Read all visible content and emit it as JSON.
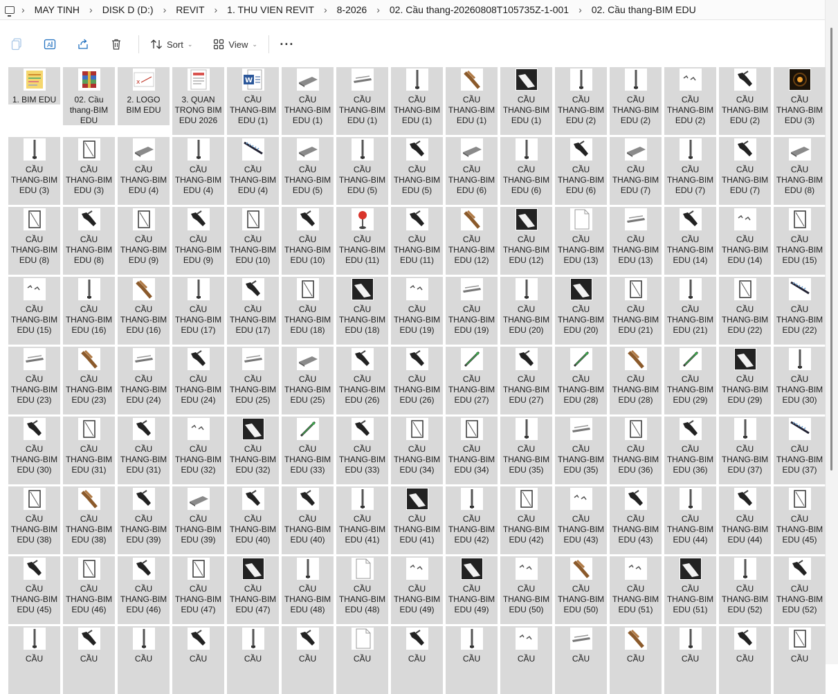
{
  "breadcrumb": {
    "icon": "computer-icon",
    "items": [
      "MAY TINH",
      "DISK D (D:)",
      "REVIT",
      "1. THU VIEN REVIT",
      "8-2026",
      "02. Cầu thang-20260808T105735Z-1-001",
      "02. Cầu thang-BIM EDU"
    ],
    "separator": "›"
  },
  "toolbar": {
    "sort_label": "Sort",
    "view_label": "View",
    "more_label": "···",
    "icons": [
      "copy-icon",
      "rename-icon",
      "share-icon",
      "delete-icon",
      "sort-icon",
      "view-icon",
      "more-icon"
    ]
  },
  "files": [
    {
      "name": "1. BIM EDU",
      "icon": "note-icon",
      "h": "short"
    },
    {
      "name": "02. Cầu thang-BIM EDU",
      "icon": "archive-icon",
      "h": "mid"
    },
    {
      "name": "2. LOGO BIM EDU",
      "icon": "logo-icon",
      "h": "mid"
    },
    {
      "name": "3. QUAN TRỌNG BIM EDU 2026",
      "icon": "doc-icon",
      "h": "full"
    },
    {
      "name": "CẦU THANG-BIM EDU (1)",
      "icon": "word-icon"
    },
    {
      "name": "CẦU THANG-BIM EDU (1)",
      "icon": "slab-icon"
    },
    {
      "name": "CẦU THANG-BIM EDU (1)",
      "icon": "flat-icon"
    },
    {
      "name": "CẦU THANG-BIM EDU (1)",
      "icon": "post-icon"
    },
    {
      "name": "CẦU THANG-BIM EDU (1)",
      "icon": "wood-icon"
    },
    {
      "name": "CẦU THANG-BIM EDU (1)",
      "icon": "dark-icon"
    },
    {
      "name": "CẦU THANG-BIM EDU (2)",
      "icon": "post-icon"
    },
    {
      "name": "CẦU THANG-BIM EDU (2)",
      "icon": "post-icon"
    },
    {
      "name": "CẦU THANG-BIM EDU (2)",
      "icon": "small-icon"
    },
    {
      "name": "CẦU THANG-BIM EDU (2)",
      "icon": "stair-icon"
    },
    {
      "name": "CẦU THANG-BIM EDU (3)",
      "icon": "night-icon"
    },
    {
      "name": "CẦU THANG-BIM EDU (3)",
      "icon": "post-icon"
    },
    {
      "name": "CẦU THANG-BIM EDU (3)",
      "icon": "frame-icon"
    },
    {
      "name": "CẦU THANG-BIM EDU (4)",
      "icon": "slab-icon"
    },
    {
      "name": "CẦU THANG-BIM EDU (4)",
      "icon": "post-icon"
    },
    {
      "name": "CẦU THANG-BIM EDU (4)",
      "icon": "diag-icon"
    },
    {
      "name": "CẦU THANG-BIM EDU (5)",
      "icon": "slab-icon"
    },
    {
      "name": "CẦU THANG-BIM EDU (5)",
      "icon": "post-icon"
    },
    {
      "name": "CẦU THANG-BIM EDU (5)",
      "icon": "stair-icon"
    },
    {
      "name": "CẦU THANG-BIM EDU (6)",
      "icon": "slab-icon"
    },
    {
      "name": "CẦU THANG-BIM EDU (6)",
      "icon": "post-icon"
    },
    {
      "name": "CẦU THANG-BIM EDU (6)",
      "icon": "stair-icon"
    },
    {
      "name": "CẦU THANG-BIM EDU (7)",
      "icon": "slab-icon"
    },
    {
      "name": "CẦU THANG-BIM EDU (7)",
      "icon": "post-icon"
    },
    {
      "name": "CẦU THANG-BIM EDU (7)",
      "icon": "stair-icon"
    },
    {
      "name": "CẦU THANG-BIM EDU (8)",
      "icon": "slab-icon"
    },
    {
      "name": "CẦU THANG-BIM EDU (8)",
      "icon": "frame-icon"
    },
    {
      "name": "CẦU THANG-BIM EDU (8)",
      "icon": "stair-icon"
    },
    {
      "name": "CẦU THANG-BIM EDU (9)",
      "icon": "frame-icon"
    },
    {
      "name": "CẦU THANG-BIM EDU (9)",
      "icon": "stair-icon"
    },
    {
      "name": "CẦU THANG-BIM EDU (10)",
      "icon": "frame-icon"
    },
    {
      "name": "CẦU THANG-BIM EDU (10)",
      "icon": "stair-icon"
    },
    {
      "name": "CẦU THANG-BIM EDU (11)",
      "icon": "red-icon"
    },
    {
      "name": "CẦU THANG-BIM EDU (11)",
      "icon": "stair-icon"
    },
    {
      "name": "CẦU THANG-BIM EDU (12)",
      "icon": "wood-icon"
    },
    {
      "name": "CẦU THANG-BIM EDU (12)",
      "icon": "dark-icon"
    },
    {
      "name": "CẦU THANG-BIM EDU (13)",
      "icon": "blank-icon"
    },
    {
      "name": "CẦU THANG-BIM EDU (13)",
      "icon": "flat-icon"
    },
    {
      "name": "CẦU THANG-BIM EDU (14)",
      "icon": "stair-icon"
    },
    {
      "name": "CẦU THANG-BIM EDU (14)",
      "icon": "small-icon"
    },
    {
      "name": "CẦU THANG-BIM EDU (15)",
      "icon": "frame-icon"
    },
    {
      "name": "CẦU THANG-BIM EDU (15)",
      "icon": "small-icon"
    },
    {
      "name": "CẦU THANG-BIM EDU (16)",
      "icon": "post-icon"
    },
    {
      "name": "CẦU THANG-BIM EDU (16)",
      "icon": "wood-icon"
    },
    {
      "name": "CẦU THANG-BIM EDU (17)",
      "icon": "post-icon"
    },
    {
      "name": "CẦU THANG-BIM EDU (17)",
      "icon": "stair-icon"
    },
    {
      "name": "CẦU THANG-BIM EDU (18)",
      "icon": "frame-icon"
    },
    {
      "name": "CẦU THANG-BIM EDU (18)",
      "icon": "dark-icon"
    },
    {
      "name": "CẦU THANG-BIM EDU (19)",
      "icon": "small-icon"
    },
    {
      "name": "CẦU THANG-BIM EDU (19)",
      "icon": "flat-icon"
    },
    {
      "name": "CẦU THANG-BIM EDU (20)",
      "icon": "post-icon"
    },
    {
      "name": "CẦU THANG-BIM EDU (20)",
      "icon": "dark-icon"
    },
    {
      "name": "CẦU THANG-BIM EDU (21)",
      "icon": "frame-icon"
    },
    {
      "name": "CẦU THANG-BIM EDU (21)",
      "icon": "post-icon"
    },
    {
      "name": "CẦU THANG-BIM EDU (22)",
      "icon": "frame-icon"
    },
    {
      "name": "CẦU THANG-BIM EDU (22)",
      "icon": "diag-icon"
    },
    {
      "name": "CẦU THANG-BIM EDU (23)",
      "icon": "flat-icon"
    },
    {
      "name": "CẦU THANG-BIM EDU (23)",
      "icon": "wood-icon"
    },
    {
      "name": "CẦU THANG-BIM EDU (24)",
      "icon": "flat-icon"
    },
    {
      "name": "CẦU THANG-BIM EDU (24)",
      "icon": "stair-icon"
    },
    {
      "name": "CẦU THANG-BIM EDU (25)",
      "icon": "flat-icon"
    },
    {
      "name": "CẦU THANG-BIM EDU (25)",
      "icon": "slab-icon"
    },
    {
      "name": "CẦU THANG-BIM EDU (26)",
      "icon": "stair-icon"
    },
    {
      "name": "CẦU THANG-BIM EDU (26)",
      "icon": "stair-icon"
    },
    {
      "name": "CẦU THANG-BIM EDU (27)",
      "icon": "green-icon"
    },
    {
      "name": "CẦU THANG-BIM EDU (27)",
      "icon": "stair-icon"
    },
    {
      "name": "CẦU THANG-BIM EDU (28)",
      "icon": "green-icon"
    },
    {
      "name": "CẦU THANG-BIM EDU (28)",
      "icon": "wood-icon"
    },
    {
      "name": "CẦU THANG-BIM EDU (29)",
      "icon": "green-icon"
    },
    {
      "name": "CẦU THANG-BIM EDU (29)",
      "icon": "dark-icon"
    },
    {
      "name": "CẦU THANG-BIM EDU (30)",
      "icon": "post-icon"
    },
    {
      "name": "CẦU THANG-BIM EDU (30)",
      "icon": "stair-icon"
    },
    {
      "name": "CẦU THANG-BIM EDU (31)",
      "icon": "frame-icon"
    },
    {
      "name": "CẦU THANG-BIM EDU (31)",
      "icon": "stair-icon"
    },
    {
      "name": "CẦU THANG-BIM EDU (32)",
      "icon": "small-icon"
    },
    {
      "name": "CẦU THANG-BIM EDU (32)",
      "icon": "dark-icon"
    },
    {
      "name": "CẦU THANG-BIM EDU (33)",
      "icon": "green-icon"
    },
    {
      "name": "CẦU THANG-BIM EDU (33)",
      "icon": "stair-icon"
    },
    {
      "name": "CẦU THANG-BIM EDU (34)",
      "icon": "frame-icon"
    },
    {
      "name": "CẦU THANG-BIM EDU (34)",
      "icon": "frame-icon"
    },
    {
      "name": "CẦU THANG-BIM EDU (35)",
      "icon": "post-icon"
    },
    {
      "name": "CẦU THANG-BIM EDU (35)",
      "icon": "flat-icon"
    },
    {
      "name": "CẦU THANG-BIM EDU (36)",
      "icon": "frame-icon"
    },
    {
      "name": "CẦU THANG-BIM EDU (36)",
      "icon": "stair-icon"
    },
    {
      "name": "CẦU THANG-BIM EDU (37)",
      "icon": "post-icon"
    },
    {
      "name": "CẦU THANG-BIM EDU (37)",
      "icon": "diag-icon"
    },
    {
      "name": "CẦU THANG-BIM EDU (38)",
      "icon": "frame-icon"
    },
    {
      "name": "CẦU THANG-BIM EDU (38)",
      "icon": "wood-icon"
    },
    {
      "name": "CẦU THANG-BIM EDU (39)",
      "icon": "stair-icon"
    },
    {
      "name": "CẦU THANG-BIM EDU (39)",
      "icon": "slab-icon"
    },
    {
      "name": "CẦU THANG-BIM EDU (40)",
      "icon": "stair-icon"
    },
    {
      "name": "CẦU THANG-BIM EDU (40)",
      "icon": "stair-icon"
    },
    {
      "name": "CẦU THANG-BIM EDU (41)",
      "icon": "post-icon"
    },
    {
      "name": "CẦU THANG-BIM EDU (41)",
      "icon": "dark-icon"
    },
    {
      "name": "CẦU THANG-BIM EDU (42)",
      "icon": "post-icon"
    },
    {
      "name": "CẦU THANG-BIM EDU (42)",
      "icon": "frame-icon"
    },
    {
      "name": "CẦU THANG-BIM EDU (43)",
      "icon": "small-icon"
    },
    {
      "name": "CẦU THANG-BIM EDU (43)",
      "icon": "stair-icon"
    },
    {
      "name": "CẦU THANG-BIM EDU (44)",
      "icon": "post-icon"
    },
    {
      "name": "CẦU THANG-BIM EDU (44)",
      "icon": "stair-icon"
    },
    {
      "name": "CẦU THANG-BIM EDU (45)",
      "icon": "frame-icon"
    },
    {
      "name": "CẦU THANG-BIM EDU (45)",
      "icon": "stair-icon"
    },
    {
      "name": "CẦU THANG-BIM EDU (46)",
      "icon": "frame-icon"
    },
    {
      "name": "CẦU THANG-BIM EDU (46)",
      "icon": "stair-icon"
    },
    {
      "name": "CẦU THANG-BIM EDU (47)",
      "icon": "frame-icon"
    },
    {
      "name": "CẦU THANG-BIM EDU (47)",
      "icon": "dark-icon"
    },
    {
      "name": "CẦU THANG-BIM EDU (48)",
      "icon": "post-icon"
    },
    {
      "name": "CẦU THANG-BIM EDU (48)",
      "icon": "blank-icon"
    },
    {
      "name": "CẦU THANG-BIM EDU (49)",
      "icon": "small-icon"
    },
    {
      "name": "CẦU THANG-BIM EDU (49)",
      "icon": "dark-icon"
    },
    {
      "name": "CẦU THANG-BIM EDU (50)",
      "icon": "small-icon"
    },
    {
      "name": "CẦU THANG-BIM EDU (50)",
      "icon": "wood-icon"
    },
    {
      "name": "CẦU THANG-BIM EDU (51)",
      "icon": "small-icon"
    },
    {
      "name": "CẦU THANG-BIM EDU (51)",
      "icon": "dark-icon"
    },
    {
      "name": "CẦU THANG-BIM EDU (52)",
      "icon": "post-icon"
    },
    {
      "name": "CẦU THANG-BIM EDU (52)",
      "icon": "stair-icon"
    },
    {
      "name": "CẦU",
      "icon": "post-icon",
      "partial": true
    },
    {
      "name": "CẦU",
      "icon": "stair-icon",
      "partial": true
    },
    {
      "name": "CẦU",
      "icon": "post-icon",
      "partial": true
    },
    {
      "name": "CẦU",
      "icon": "stair-icon",
      "partial": true
    },
    {
      "name": "CẦU",
      "icon": "post-icon",
      "partial": true
    },
    {
      "name": "CẦU",
      "icon": "stair-icon",
      "partial": true
    },
    {
      "name": "CẦU",
      "icon": "blank-icon",
      "partial": true
    },
    {
      "name": "CẦU",
      "icon": "stair-icon",
      "partial": true
    },
    {
      "name": "CẦU",
      "icon": "post-icon",
      "partial": true
    },
    {
      "name": "CẦU",
      "icon": "small-icon",
      "partial": true
    },
    {
      "name": "CẦU",
      "icon": "flat-icon",
      "partial": true
    },
    {
      "name": "CẦU",
      "icon": "wood-icon",
      "partial": true
    },
    {
      "name": "CẦU",
      "icon": "post-icon",
      "partial": true
    },
    {
      "name": "CẦU",
      "icon": "stair-icon",
      "partial": true
    },
    {
      "name": "CẦU",
      "icon": "frame-icon",
      "partial": true
    }
  ]
}
